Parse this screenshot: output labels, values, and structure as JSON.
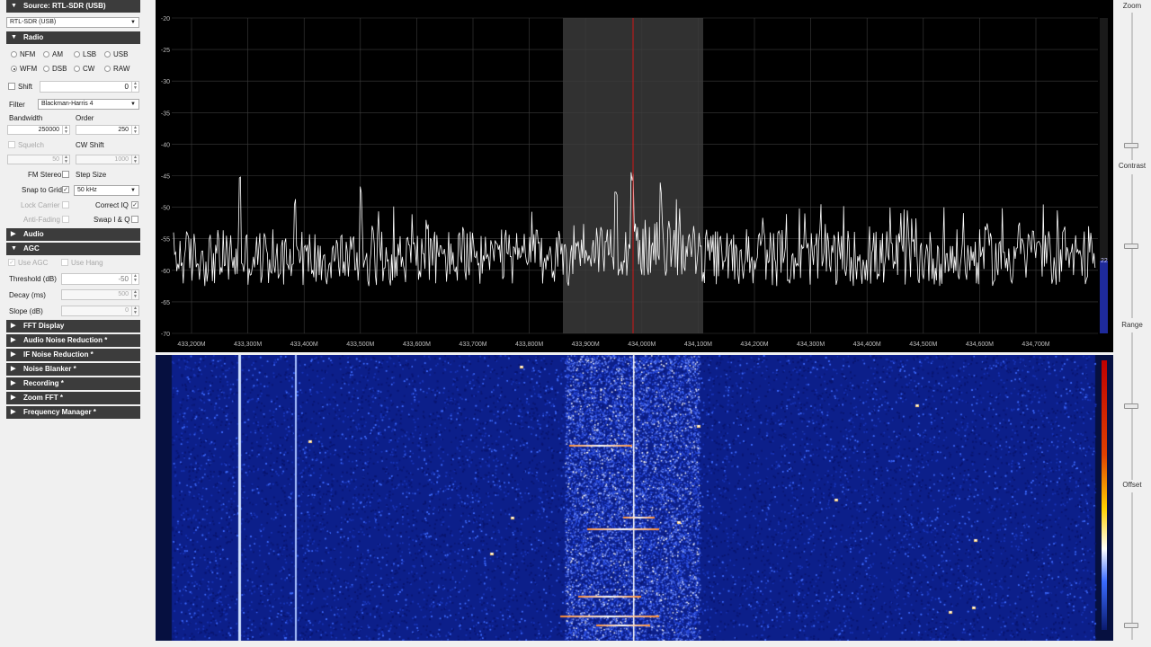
{
  "sidebar": {
    "source": {
      "header": "Source: RTL-SDR (USB)",
      "device": "RTL-SDR (USB)"
    },
    "radio": {
      "header": "Radio",
      "modes": [
        "NFM",
        "AM",
        "LSB",
        "USB",
        "WFM",
        "DSB",
        "CW",
        "RAW"
      ],
      "selected_mode": "WFM",
      "shift_label": "Shift",
      "shift_value": "0",
      "filter_label": "Filter",
      "filter_value": "Blackman-Harris 4",
      "bandwidth_label": "Bandwidth",
      "bandwidth_value": "250000",
      "order_label": "Order",
      "order_value": "250",
      "squelch_label": "Squelch",
      "squelch_value": "50",
      "cw_shift_label": "CW Shift",
      "cw_shift_value": "1000",
      "fm_stereo_label": "FM Stereo",
      "step_size_label": "Step Size",
      "snap_label": "Snap to Grid",
      "snap_value": "50 kHz",
      "lock_carrier_label": "Lock Carrier",
      "correct_iq_label": "Correct IQ",
      "anti_fading_label": "Anti-Fading",
      "swap_iq_label": "Swap I & Q"
    },
    "audio_header": "Audio",
    "agc": {
      "header": "AGC",
      "use_agc_label": "Use AGC",
      "use_hang_label": "Use Hang",
      "threshold_label": "Threshold (dB)",
      "threshold_value": "-50",
      "decay_label": "Decay (ms)",
      "decay_value": "500",
      "slope_label": "Slope (dB)",
      "slope_value": "0"
    },
    "collapsed_panels": [
      "FFT Display",
      "Audio Noise Reduction *",
      "IF Noise Reduction *",
      "Noise Blanker *",
      "Recording *",
      "Zoom FFT *",
      "Frequency Manager *"
    ]
  },
  "spectrum": {
    "y_ticks": [
      "-20",
      "-25",
      "-30",
      "-35",
      "-40",
      "-45",
      "-50",
      "-55",
      "-60",
      "-65",
      "-70"
    ],
    "x_ticks": [
      "433,200M",
      "433,300M",
      "433,400M",
      "433,500M",
      "433,600M",
      "433,700M",
      "433,800M",
      "433,900M",
      "434,000M",
      "434,100M",
      "434,200M",
      "434,300M",
      "434,400M",
      "434,500M",
      "434,600M",
      "434,700M"
    ],
    "level_readout": "22",
    "trace_color": "#ffffff",
    "center_line_color": "#d01818",
    "filter_band_color": "#3a3a3a"
  },
  "right_panel": {
    "zoom_label": "Zoom",
    "contrast_label": "Contrast",
    "range_label": "Range",
    "offset_label": "Offset",
    "zoom_level": 0.1,
    "contrast_level": 0.5,
    "range_level": 0.5,
    "offset_level": 0.1
  }
}
